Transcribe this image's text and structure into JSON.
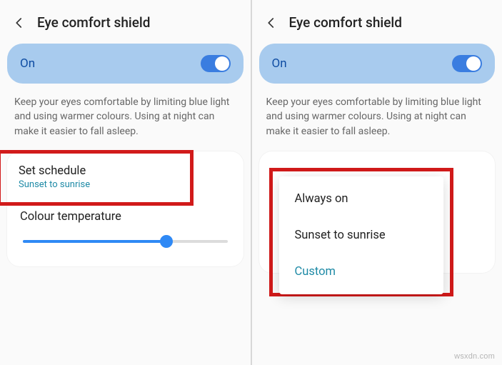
{
  "header": {
    "title": "Eye comfort shield"
  },
  "toggle": {
    "label": "On"
  },
  "description": "Keep your eyes comfortable by limiting blue light and using warmer colours. Using at night can make it easier to fall asleep.",
  "schedule": {
    "title": "Set schedule",
    "subtitle": "Sunset to sunrise"
  },
  "colour_temp": {
    "label": "Colour temperature",
    "value_pct": 70
  },
  "popup": {
    "items": [
      "Always on",
      "Sunset to sunrise",
      "Custom"
    ]
  },
  "watermark": "wsxdn.com",
  "colors": {
    "accent": "#2f89f5",
    "highlight": "#d11a1a",
    "teal": "#1e8aa6"
  }
}
